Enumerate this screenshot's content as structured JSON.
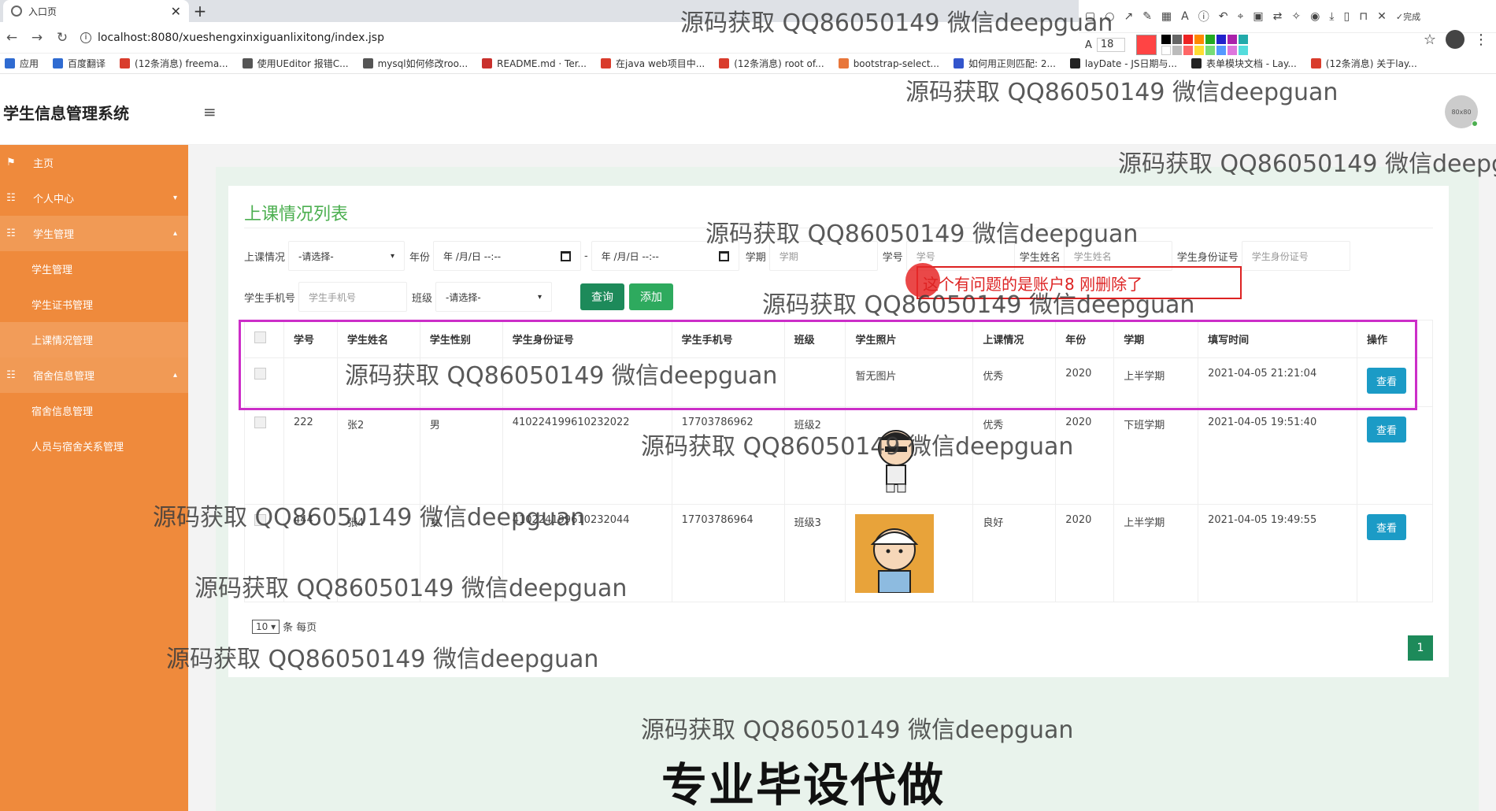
{
  "browser": {
    "tab_title": "入口页",
    "tab_close": "✕",
    "new_tab": "+",
    "url": "localhost:8080/xueshengxinxiguanlixitong/index.jsp",
    "done_label": "完成",
    "font_size": "18",
    "bookmarks": [
      {
        "label": "应用",
        "color": "#2f6bd1"
      },
      {
        "label": "百度翻译",
        "color": "#2f6bd1"
      },
      {
        "label": "(12条消息) freema...",
        "color": "#d93c2c"
      },
      {
        "label": "使用UEditor 报错C...",
        "color": "#555555"
      },
      {
        "label": "mysql如何修改roo...",
        "color": "#555555"
      },
      {
        "label": "README.md · Ter...",
        "color": "#c9302c"
      },
      {
        "label": "在java web项目中...",
        "color": "#d93c2c"
      },
      {
        "label": "(12条消息) root of...",
        "color": "#d93c2c"
      },
      {
        "label": "bootstrap-select...",
        "color": "#e8763a"
      },
      {
        "label": "如何用正则匹配: 2...",
        "color": "#3355cc"
      },
      {
        "label": "layDate - JS日期与...",
        "color": "#222222"
      },
      {
        "label": "表单模块文档 - Lay...",
        "color": "#222222"
      },
      {
        "label": "(12条消息) 关于lay...",
        "color": "#d93c2c"
      }
    ]
  },
  "app": {
    "title": "学生信息管理系统",
    "menu_icon": "≡",
    "avatar_text": "80x80"
  },
  "sidebar": {
    "items": [
      {
        "label": "主页",
        "icon": "flag-icon",
        "type": "item"
      },
      {
        "label": "个人中心",
        "icon": "grid-icon",
        "type": "item",
        "caret": "▾"
      },
      {
        "label": "学生管理",
        "icon": "grid-icon",
        "type": "item",
        "caret": "▴"
      },
      {
        "label": "学生管理",
        "type": "sub"
      },
      {
        "label": "学生证书管理",
        "type": "sub"
      },
      {
        "label": "上课情况管理",
        "type": "sub",
        "active": true
      },
      {
        "label": "宿舍信息管理",
        "icon": "grid-icon",
        "type": "item",
        "caret": "▴"
      },
      {
        "label": "宿舍信息管理",
        "type": "sub"
      },
      {
        "label": "人员与宿舍关系管理",
        "type": "sub"
      }
    ]
  },
  "panel": {
    "title": "上课情况列表",
    "filters": {
      "attendance_label": "上课情况",
      "attendance_value": "-请选择-",
      "year_label": "年份",
      "date_placeholder": "年 /月/日 --:--",
      "date_separator": "-",
      "semester_label": "学期",
      "semester_placeholder": "学期",
      "student_id_label": "学号",
      "student_id_placeholder": "学号",
      "student_name_label": "学生姓名",
      "student_name_placeholder": "学生姓名",
      "id_card_label": "学生身份证号",
      "id_card_placeholder": "学生身份证号",
      "phone_label": "学生手机号",
      "phone_placeholder": "学生手机号",
      "class_label": "班级",
      "class_value": "-请选择-",
      "query_button": "查询",
      "add_button": "添加"
    },
    "table": {
      "headers": [
        "学号",
        "学生姓名",
        "学生性别",
        "学生身份证号",
        "学生手机号",
        "班级",
        "学生照片",
        "上课情况",
        "年份",
        "学期",
        "填写时间",
        "操作"
      ],
      "rows": [
        {
          "id": "",
          "name": "",
          "gender": "",
          "id_card": "",
          "phone": "",
          "class": "",
          "photo": "暂无图片",
          "attendance": "优秀",
          "year": "2020",
          "semester": "上半学期",
          "time": "2021-04-05 21:21:04",
          "action": "查看"
        },
        {
          "id": "222",
          "name": "张2",
          "gender": "男",
          "id_card": "410224199610232022",
          "phone": "17703786962",
          "class": "班级2",
          "photo": "",
          "attendance": "优秀",
          "year": "2020",
          "semester": "下班学期",
          "time": "2021-04-05 19:51:40",
          "action": "查看"
        },
        {
          "id": "444",
          "name": "张4",
          "gender": "女",
          "id_card": "410224199610232044",
          "phone": "17703786964",
          "class": "班级3",
          "photo": "",
          "attendance": "良好",
          "year": "2020",
          "semester": "上半学期",
          "time": "2021-04-05 19:49:55",
          "action": "查看"
        }
      ]
    },
    "pager": {
      "page_size": "10",
      "page_size_suffix": "条 每页",
      "current_page": "1"
    }
  },
  "annotation": {
    "text": "这个有问题的是账户8  刚删除了"
  },
  "watermark": "源码获取 QQ86050149 微信deepguan",
  "watermark_partial": "源码获取 QQ86050149 微信deepg",
  "watermark_top": "源码获取 QQ86050149 微信deepguan",
  "banner": "专业毕设代做",
  "colors": {
    "sidebar": "#ef8a3c",
    "accent_green": "#4caf50",
    "query_button": "#1d8a5a",
    "view_button": "#1b9bc6",
    "highlight": "#cc2ec8",
    "annotation": "#dd2222"
  }
}
